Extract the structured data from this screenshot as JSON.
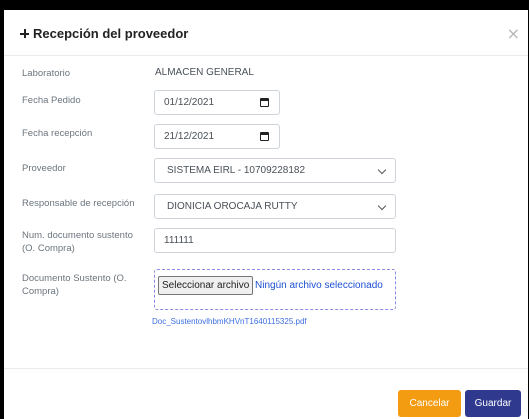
{
  "modal": {
    "title": "Recepción del proveedor",
    "close_symbol": "×"
  },
  "form": {
    "laboratorio": {
      "label": "Laboratorio",
      "value": "ALMACEN GENERAL"
    },
    "fecha_pedido": {
      "label": "Fecha Pedido",
      "value": "01/12/2021"
    },
    "fecha_recepcion": {
      "label": "Fecha recepción",
      "value": "21/12/2021"
    },
    "proveedor": {
      "label": "Proveedor",
      "value": "SISTEMA EIRL - 10709228182"
    },
    "responsable": {
      "label": "Responsable de recepción",
      "value": "DIONICIA OROCAJA RUTTY"
    },
    "num_documento": {
      "label_line1": "Num. documento sustento",
      "label_line2": "(O. Compra)",
      "value": "111111"
    },
    "documento": {
      "label_line1": "Documento Sustento (O.",
      "label_line2": "Compra)",
      "button": "Seleccionar archivo",
      "status": "Ningún archivo seleccionado",
      "link": "Doc_SustentovlhbmKHVnT1640115325.pdf"
    }
  },
  "footer": {
    "cancel_label": "Cancelar",
    "save_label": "Guardar"
  },
  "colors": {
    "cancel": "#f39c12",
    "save": "#2f3a8f",
    "link": "#3d6fe0"
  },
  "icons": [
    "plus-icon",
    "close-icon",
    "calendar-icon",
    "chevron-down-icon"
  ]
}
